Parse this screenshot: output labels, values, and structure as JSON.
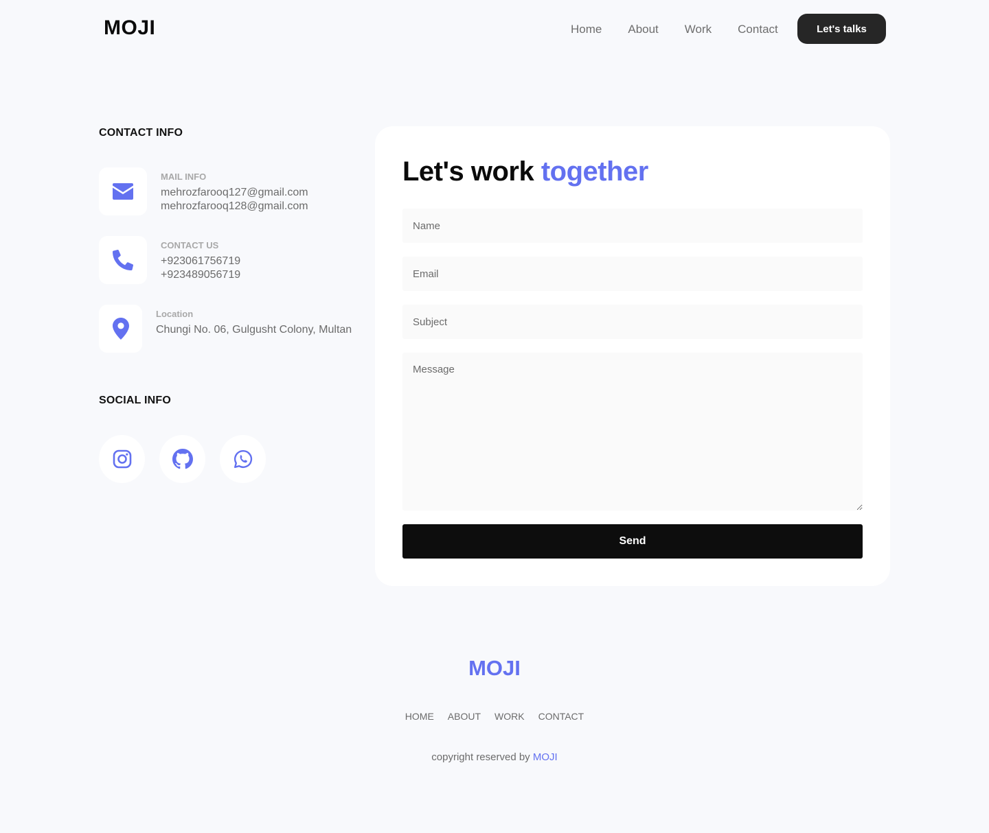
{
  "header": {
    "logo": "MOJI",
    "nav": [
      "Home",
      "About",
      "Work",
      "Contact"
    ],
    "cta": "Let's talks"
  },
  "contact": {
    "title": "CONTACT INFO",
    "mail": {
      "label": "MAIL INFO",
      "lines": [
        "mehrozfarooq127@gmail.com",
        "mehrozfarooq128@gmail.com"
      ],
      "icon": "envelope-icon"
    },
    "phone": {
      "label": "CONTACT US",
      "lines": [
        "+923061756719",
        "+923489056719"
      ],
      "icon": "phone-icon"
    },
    "location": {
      "label": "Location",
      "lines": [
        "Chungi No. 06, Gulgusht Colony, Multan"
      ],
      "icon": "map-pin-icon"
    }
  },
  "social": {
    "title": "SOCIAL INFO",
    "icons": [
      "instagram-icon",
      "github-icon",
      "whatsapp-icon"
    ]
  },
  "form": {
    "title_main": "Let's work",
    "title_accent": "together",
    "name_placeholder": "Name",
    "email_placeholder": "Email",
    "subject_placeholder": "Subject",
    "message_placeholder": "Message",
    "send_label": "Send"
  },
  "footer": {
    "logo": "MOJI",
    "nav": [
      "HOME",
      "ABOUT",
      "WORK",
      "CONTACT"
    ],
    "copyright_prefix": "copyright reserved by",
    "copyright_brand": "MOJI"
  },
  "colors": {
    "accent": "#6371f0",
    "background": "#f8f9fc",
    "dark_button": "#262626",
    "send_button": "#0d0d0d"
  }
}
